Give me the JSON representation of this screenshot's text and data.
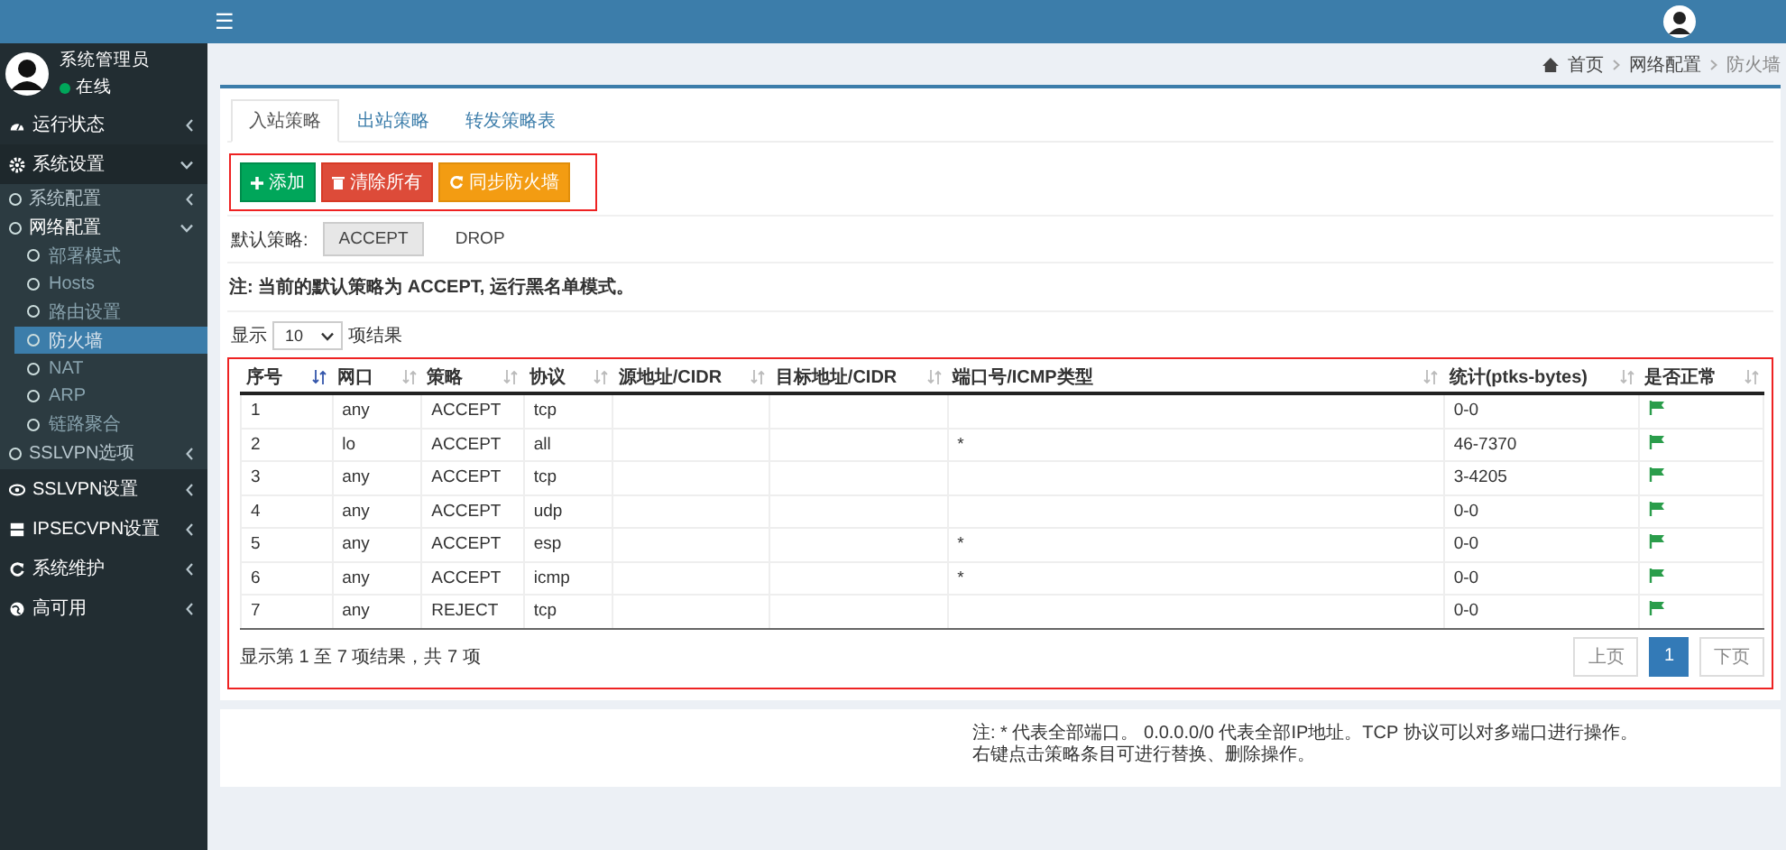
{
  "header": {
    "menu_toggle": "☰"
  },
  "user": {
    "name": "系统管理员",
    "status": "在线",
    "online": true
  },
  "sidebar": {
    "items": [
      {
        "label": "运行状态",
        "kind": "dashboard",
        "expanded": false
      },
      {
        "label": "系统设置",
        "kind": "gear",
        "expanded": true,
        "children": [
          {
            "label": "系统配置",
            "expanded": false
          },
          {
            "label": "网络配置",
            "expanded": true,
            "children": [
              {
                "label": "部署模式",
                "selected": false
              },
              {
                "label": "Hosts",
                "selected": false
              },
              {
                "label": "路由设置",
                "selected": false
              },
              {
                "label": "防火墙",
                "selected": true
              },
              {
                "label": "NAT",
                "selected": false
              },
              {
                "label": "ARP",
                "selected": false
              },
              {
                "label": "链路聚合",
                "selected": false
              }
            ]
          },
          {
            "label": "SSLVPN选项",
            "expanded": false
          }
        ]
      },
      {
        "label": "SSLVPN设置",
        "kind": "eye",
        "expanded": false
      },
      {
        "label": "IPSECVPN设置",
        "kind": "server",
        "expanded": false
      },
      {
        "label": "系统维护",
        "kind": "refresh",
        "expanded": false
      },
      {
        "label": "高可用",
        "kind": "globe",
        "expanded": false
      }
    ]
  },
  "breadcrumb": [
    "首页",
    "网络配置",
    "防火墙"
  ],
  "tabs": [
    {
      "label": "入站策略",
      "selected": true
    },
    {
      "label": "出站策略",
      "selected": false
    },
    {
      "label": "转发策略表",
      "selected": false
    }
  ],
  "actions": [
    {
      "label": "添加",
      "kind": "add"
    },
    {
      "label": "清除所有",
      "kind": "delete"
    },
    {
      "label": "同步防火墙",
      "kind": "sync"
    }
  ],
  "default_policy": {
    "label": "默认策略:",
    "options": [
      {
        "label": "ACCEPT",
        "selected": true
      },
      {
        "label": "DROP",
        "selected": false
      }
    ]
  },
  "note": "注: 当前的默认策略为 ACCEPT, 运行黑名单模式。",
  "page_size": {
    "prefix": "显示",
    "value": "10",
    "suffix": "项结果"
  },
  "table": {
    "columns": [
      {
        "label": "序号",
        "sorted": true
      },
      {
        "label": "网口",
        "sorted": false
      },
      {
        "label": "策略",
        "sorted": false
      },
      {
        "label": "协议",
        "sorted": false
      },
      {
        "label": "源地址/CIDR",
        "sorted": false
      },
      {
        "label": "目标地址/CIDR",
        "sorted": false
      },
      {
        "label": "端口号/ICMP类型",
        "sorted": false
      },
      {
        "label": "统计(ptks-bytes)",
        "sorted": false
      },
      {
        "label": "是否正常",
        "sorted": false
      }
    ],
    "rows": [
      {
        "cells": [
          "1",
          "any",
          "ACCEPT",
          "tcp",
          "",
          "",
          "",
          "0-0"
        ],
        "normal": true
      },
      {
        "cells": [
          "2",
          "lo",
          "ACCEPT",
          "all",
          "",
          "",
          "*",
          "46-7370"
        ],
        "normal": true
      },
      {
        "cells": [
          "3",
          "any",
          "ACCEPT",
          "tcp",
          "",
          "",
          "",
          "3-4205"
        ],
        "normal": true
      },
      {
        "cells": [
          "4",
          "any",
          "ACCEPT",
          "udp",
          "",
          "",
          "",
          "0-0"
        ],
        "normal": true
      },
      {
        "cells": [
          "5",
          "any",
          "ACCEPT",
          "esp",
          "",
          "",
          "*",
          "0-0"
        ],
        "normal": true
      },
      {
        "cells": [
          "6",
          "any",
          "ACCEPT",
          "icmp",
          "",
          "",
          "*",
          "0-0"
        ],
        "normal": true
      },
      {
        "cells": [
          "7",
          "any",
          "REJECT",
          "tcp",
          "",
          "",
          "",
          "0-0"
        ],
        "normal": true
      }
    ],
    "info": "显示第 1 至 7 项结果，共 7 项"
  },
  "pagination": [
    {
      "label": "上页",
      "selected": false
    },
    {
      "label": "1",
      "selected": true
    },
    {
      "label": "下页",
      "selected": false
    }
  ],
  "footer_notes": [
    "注: * 代表全部端口。 0.0.0.0/0 代表全部IP地址。TCP 协议可以对多端口进行操作。",
    "右键点击策略条目可进行替换、删除操作。"
  ]
}
